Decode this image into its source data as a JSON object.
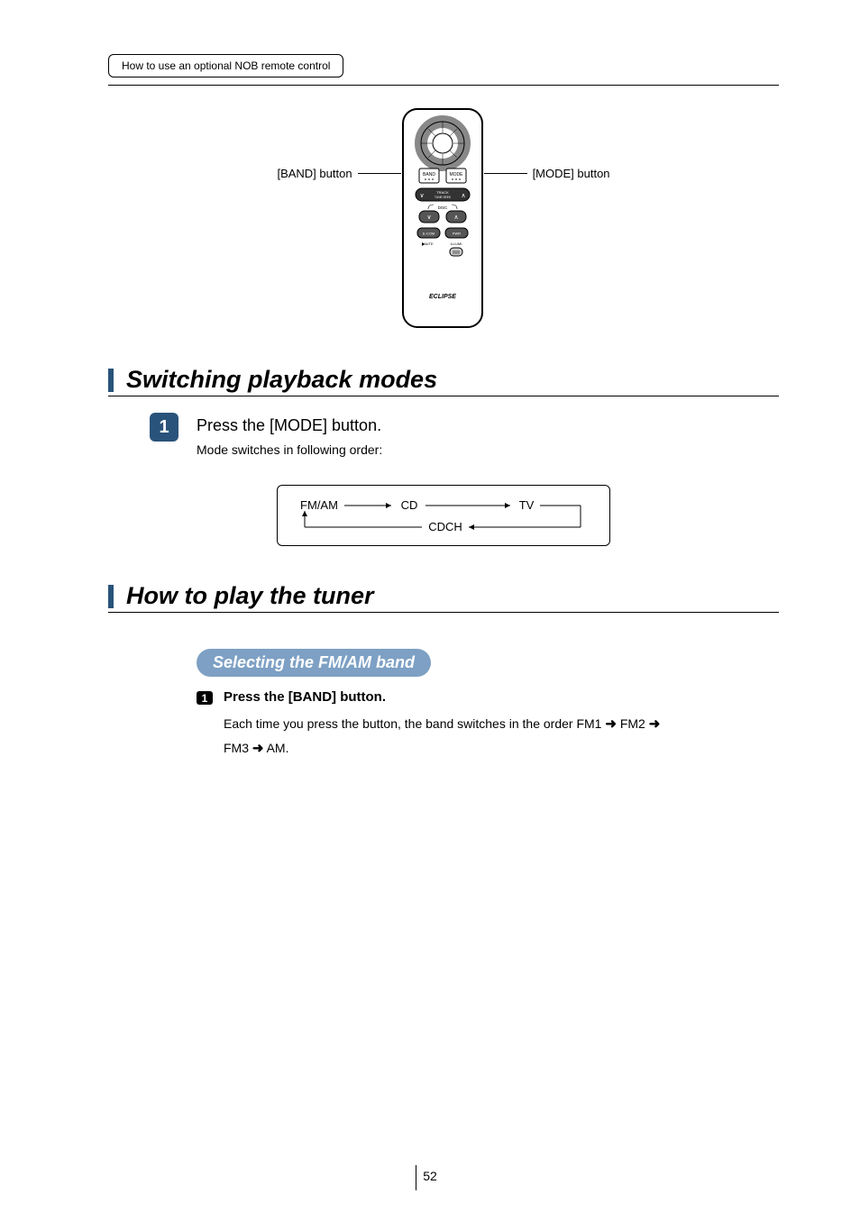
{
  "breadcrumb": "How to use an optional NOB remote control",
  "diagram": {
    "label_left": "[BAND] button",
    "label_right": "[MODE] button",
    "remote_brand": "ECLIPSE",
    "remote_buttons": {
      "band": "BAND",
      "mode": "MODE",
      "track": "TRACK",
      "tune_seek": "TUNE SEEK",
      "disc": "DISC",
      "e_com": "E-COM",
      "pwr": "PWR",
      "mute": "MUTE",
      "illumi": "ILLUMI"
    }
  },
  "section1": {
    "title": "Switching playback modes",
    "step1_num": "1",
    "step1_text": "Press the [MODE] button.",
    "step1_sub": "Mode switches in following order:",
    "flow": {
      "a": "FM/AM",
      "b": "CD",
      "c": "TV",
      "d": "CDCH"
    }
  },
  "section2": {
    "title": "How to play the tuner",
    "pill": "Selecting the FM/AM band",
    "step1_num": "1",
    "step1_text": "Press the [BAND] button.",
    "detail_line1_a": "Each time you press the button, the band switches in the order FM1",
    "detail_line1_b": "FM2",
    "detail_line2_a": "FM3",
    "detail_line2_b": "AM.",
    "arrow": "➜"
  },
  "page_number": "52"
}
